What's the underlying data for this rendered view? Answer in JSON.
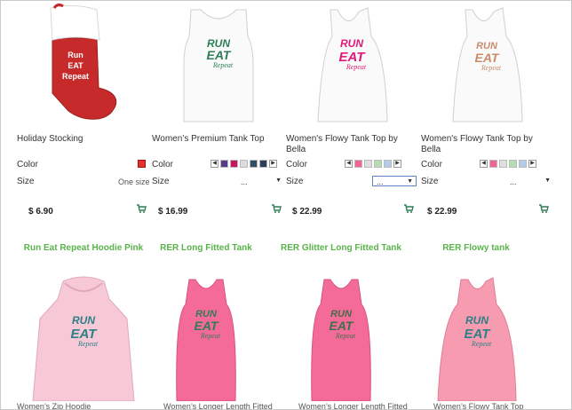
{
  "products_row1": [
    {
      "name": "Holiday Stocking",
      "color_label": "Color",
      "size_label": "Size",
      "size_value": "One size",
      "price": "$ 6.90",
      "stocking_text": [
        "Run",
        "EAT",
        "Repeat"
      ],
      "swatch_color": "#e2322c"
    },
    {
      "name": "Women’s Premium Tank Top",
      "color_label": "Color",
      "size_label": "Size",
      "size_value": "...",
      "price": "$ 16.99",
      "print": [
        "RUN",
        "EAT",
        "Repeat"
      ],
      "swatches": [
        "#5a3b8a",
        "#c2185b",
        "#dcdcdc",
        "#2f4d63",
        "#2d3c5a"
      ]
    },
    {
      "name": "Women's Flowy Tank Top by Bella",
      "color_label": "Color",
      "size_label": "Size",
      "size_value": "...",
      "price": "$ 22.99",
      "print": [
        "RUN",
        "EAT",
        "Repeat"
      ],
      "swatches": [
        "#f06493",
        "#dedede",
        "#b5ddb0",
        "#b3cbe8"
      ]
    },
    {
      "name": "Women's Flowy Tank Top by Bella",
      "color_label": "Color",
      "size_label": "Size",
      "size_value": "...",
      "price": "$ 22.99",
      "print": [
        "RUN",
        "EAT",
        "Repeat"
      ],
      "swatches": [
        "#f06493",
        "#dedede",
        "#b5ddb0",
        "#b3cbe8"
      ]
    }
  ],
  "products_row2": [
    {
      "title": "Run Eat Repeat Hoodie Pink",
      "print": [
        "RUN",
        "EAT",
        "Repeat"
      ],
      "caption": "Women’s Zip Hoodie"
    },
    {
      "title": "RER Long Fitted Tank",
      "print": [
        "RUN",
        "EAT",
        "Repeat"
      ],
      "caption": "Women’s Longer Length Fitted"
    },
    {
      "title": "RER Glitter Long Fitted Tank",
      "print": [
        "RUN",
        "EAT",
        "Repeat"
      ],
      "caption": "Women’s Longer Length Fitted"
    },
    {
      "title": "RER Flowy tank",
      "print": [
        "RUN",
        "EAT",
        "Repeat"
      ],
      "caption": "Women’s Flowy Tank Top"
    }
  ],
  "colors": {
    "accent_green": "#59b34a",
    "print_green": "#2e7d57",
    "print_pink": "#e0197a",
    "print_tan": "#c88c6a",
    "print_teal": "#2b7f86",
    "tank_pink": "#f46a98",
    "hoodie_pink": "#f7c8d6",
    "stocking_red": "#c62a2a"
  },
  "icons": {
    "cart": "cart-icon",
    "arrow_left": "arrow-left-icon",
    "arrow_right": "arrow-right-icon",
    "dropdown": "chevron-down-icon"
  }
}
